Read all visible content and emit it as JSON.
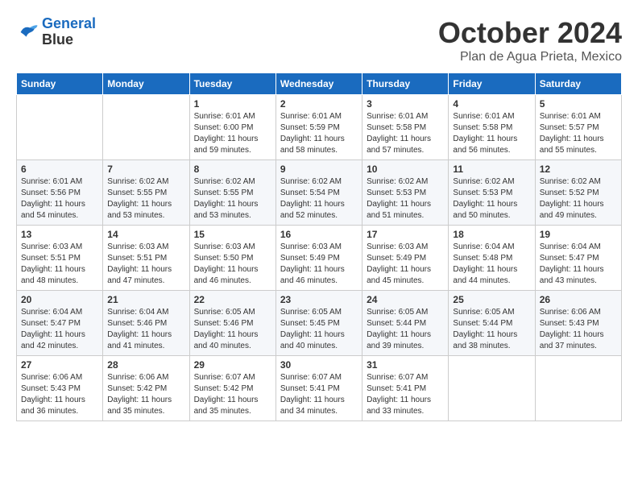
{
  "logo": {
    "line1": "General",
    "line2": "Blue"
  },
  "title": "October 2024",
  "subtitle": "Plan de Agua Prieta, Mexico",
  "days_of_week": [
    "Sunday",
    "Monday",
    "Tuesday",
    "Wednesday",
    "Thursday",
    "Friday",
    "Saturday"
  ],
  "weeks": [
    [
      {
        "day": "",
        "info": ""
      },
      {
        "day": "",
        "info": ""
      },
      {
        "day": "1",
        "info": "Sunrise: 6:01 AM\nSunset: 6:00 PM\nDaylight: 11 hours and 59 minutes."
      },
      {
        "day": "2",
        "info": "Sunrise: 6:01 AM\nSunset: 5:59 PM\nDaylight: 11 hours and 58 minutes."
      },
      {
        "day": "3",
        "info": "Sunrise: 6:01 AM\nSunset: 5:58 PM\nDaylight: 11 hours and 57 minutes."
      },
      {
        "day": "4",
        "info": "Sunrise: 6:01 AM\nSunset: 5:58 PM\nDaylight: 11 hours and 56 minutes."
      },
      {
        "day": "5",
        "info": "Sunrise: 6:01 AM\nSunset: 5:57 PM\nDaylight: 11 hours and 55 minutes."
      }
    ],
    [
      {
        "day": "6",
        "info": "Sunrise: 6:01 AM\nSunset: 5:56 PM\nDaylight: 11 hours and 54 minutes."
      },
      {
        "day": "7",
        "info": "Sunrise: 6:02 AM\nSunset: 5:55 PM\nDaylight: 11 hours and 53 minutes."
      },
      {
        "day": "8",
        "info": "Sunrise: 6:02 AM\nSunset: 5:55 PM\nDaylight: 11 hours and 53 minutes."
      },
      {
        "day": "9",
        "info": "Sunrise: 6:02 AM\nSunset: 5:54 PM\nDaylight: 11 hours and 52 minutes."
      },
      {
        "day": "10",
        "info": "Sunrise: 6:02 AM\nSunset: 5:53 PM\nDaylight: 11 hours and 51 minutes."
      },
      {
        "day": "11",
        "info": "Sunrise: 6:02 AM\nSunset: 5:53 PM\nDaylight: 11 hours and 50 minutes."
      },
      {
        "day": "12",
        "info": "Sunrise: 6:02 AM\nSunset: 5:52 PM\nDaylight: 11 hours and 49 minutes."
      }
    ],
    [
      {
        "day": "13",
        "info": "Sunrise: 6:03 AM\nSunset: 5:51 PM\nDaylight: 11 hours and 48 minutes."
      },
      {
        "day": "14",
        "info": "Sunrise: 6:03 AM\nSunset: 5:51 PM\nDaylight: 11 hours and 47 minutes."
      },
      {
        "day": "15",
        "info": "Sunrise: 6:03 AM\nSunset: 5:50 PM\nDaylight: 11 hours and 46 minutes."
      },
      {
        "day": "16",
        "info": "Sunrise: 6:03 AM\nSunset: 5:49 PM\nDaylight: 11 hours and 46 minutes."
      },
      {
        "day": "17",
        "info": "Sunrise: 6:03 AM\nSunset: 5:49 PM\nDaylight: 11 hours and 45 minutes."
      },
      {
        "day": "18",
        "info": "Sunrise: 6:04 AM\nSunset: 5:48 PM\nDaylight: 11 hours and 44 minutes."
      },
      {
        "day": "19",
        "info": "Sunrise: 6:04 AM\nSunset: 5:47 PM\nDaylight: 11 hours and 43 minutes."
      }
    ],
    [
      {
        "day": "20",
        "info": "Sunrise: 6:04 AM\nSunset: 5:47 PM\nDaylight: 11 hours and 42 minutes."
      },
      {
        "day": "21",
        "info": "Sunrise: 6:04 AM\nSunset: 5:46 PM\nDaylight: 11 hours and 41 minutes."
      },
      {
        "day": "22",
        "info": "Sunrise: 6:05 AM\nSunset: 5:46 PM\nDaylight: 11 hours and 40 minutes."
      },
      {
        "day": "23",
        "info": "Sunrise: 6:05 AM\nSunset: 5:45 PM\nDaylight: 11 hours and 40 minutes."
      },
      {
        "day": "24",
        "info": "Sunrise: 6:05 AM\nSunset: 5:44 PM\nDaylight: 11 hours and 39 minutes."
      },
      {
        "day": "25",
        "info": "Sunrise: 6:05 AM\nSunset: 5:44 PM\nDaylight: 11 hours and 38 minutes."
      },
      {
        "day": "26",
        "info": "Sunrise: 6:06 AM\nSunset: 5:43 PM\nDaylight: 11 hours and 37 minutes."
      }
    ],
    [
      {
        "day": "27",
        "info": "Sunrise: 6:06 AM\nSunset: 5:43 PM\nDaylight: 11 hours and 36 minutes."
      },
      {
        "day": "28",
        "info": "Sunrise: 6:06 AM\nSunset: 5:42 PM\nDaylight: 11 hours and 35 minutes."
      },
      {
        "day": "29",
        "info": "Sunrise: 6:07 AM\nSunset: 5:42 PM\nDaylight: 11 hours and 35 minutes."
      },
      {
        "day": "30",
        "info": "Sunrise: 6:07 AM\nSunset: 5:41 PM\nDaylight: 11 hours and 34 minutes."
      },
      {
        "day": "31",
        "info": "Sunrise: 6:07 AM\nSunset: 5:41 PM\nDaylight: 11 hours and 33 minutes."
      },
      {
        "day": "",
        "info": ""
      },
      {
        "day": "",
        "info": ""
      }
    ]
  ]
}
